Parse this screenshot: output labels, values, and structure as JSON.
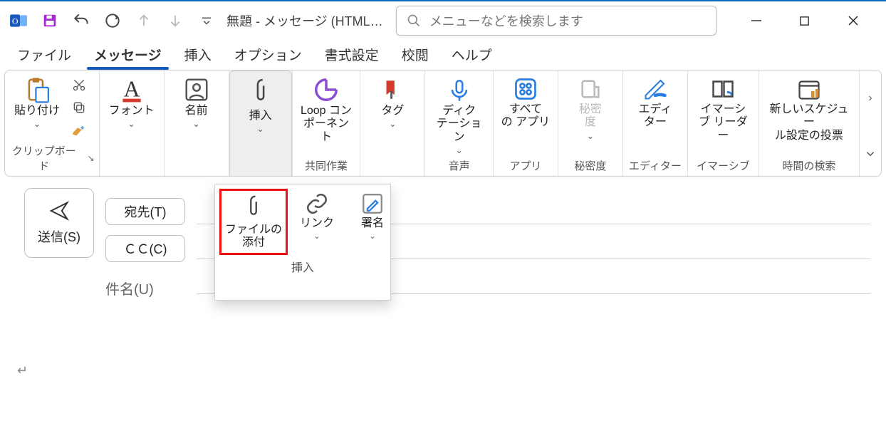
{
  "app": {
    "window_title": "無題  -  メッセージ (HTML…"
  },
  "search": {
    "placeholder": "メニューなどを検索します"
  },
  "tabs": {
    "t0": "ファイル",
    "t1": "メッセージ",
    "t2": "挿入",
    "t3": "オプション",
    "t4": "書式設定",
    "t5": "校閲",
    "t6": "ヘルプ"
  },
  "ribbon": {
    "clipboard": {
      "paste": "貼り付け",
      "group": "クリップボード"
    },
    "font": {
      "btn": "フォント"
    },
    "names": {
      "btn": "名前"
    },
    "insert": {
      "btn": "挿入"
    },
    "loop": {
      "btn": "Loop コン\nポーネント",
      "group": "共同作業"
    },
    "tag": {
      "btn": "タグ"
    },
    "dictation": {
      "btn": "ディク\nテーション",
      "group": "音声"
    },
    "apps": {
      "btn": "すべて\nの アプリ",
      "group": "アプリ"
    },
    "sensitivity": {
      "btn": "秘密\n度",
      "group": "秘密度"
    },
    "editor": {
      "btn": "エディ\nター",
      "group": "エディター"
    },
    "immersive": {
      "btn": "イマーシ\nブ リーダー",
      "group": "イマーシブ"
    },
    "schedule": {
      "btn": "新しいスケジュー\nル設定の投票",
      "group": "時間の検索"
    }
  },
  "dropdown": {
    "attach": "ファイルの\n添付",
    "link": "リンク",
    "signature": "署名",
    "group": "挿入"
  },
  "compose": {
    "send": "送信(S)",
    "to": "宛先(T)",
    "cc": "ＣＣ(C)",
    "subject": "件名(U)",
    "body_marker": "↵"
  }
}
